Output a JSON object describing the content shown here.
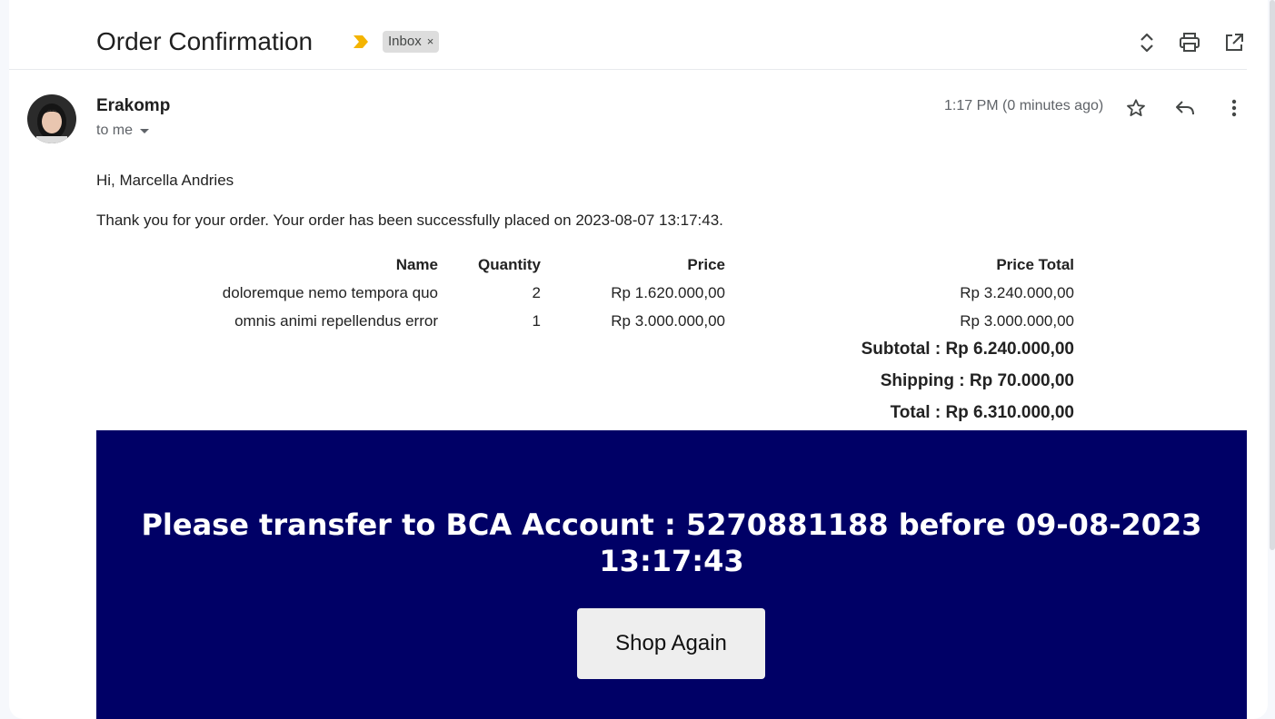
{
  "email": {
    "subject": "Order Confirmation",
    "label": "Inbox",
    "label_remove": "×",
    "sender_name": "Erakomp",
    "recipient": "to me",
    "timestamp": "1:17 PM (0 minutes ago)",
    "icons": {
      "expand": "unfold-icon",
      "print": "print-icon",
      "open_new_window": "open-in-new-icon",
      "star": "star-icon",
      "reply": "reply-icon",
      "more": "more-vert-icon",
      "importance": "importance-marker-icon"
    }
  },
  "body": {
    "greeting": "Hi, Marcella Andries",
    "message": "Thank you for your order. Your order has been successfully placed on 2023-08-07 13:17:43.",
    "table": {
      "headers": [
        "Name",
        "Quantity",
        "Price",
        "Price Total"
      ],
      "rows": [
        [
          "doloremque nemo tempora quo",
          "2",
          "Rp 1.620.000,00",
          "Rp 3.240.000,00"
        ],
        [
          "omnis animi repellendus error",
          "1",
          "Rp 3.000.000,00",
          "Rp 3.000.000,00"
        ]
      ]
    },
    "subtotal": "Subtotal : Rp 6.240.000,00",
    "shipping": "Shipping : Rp 70.000,00",
    "total": "Total : Rp 6.310.000,00",
    "banner": {
      "text": "Please transfer to BCA Account : 5270881188 before 09-08-2023 13:17:43",
      "button": "Shop Again",
      "background": "#000066"
    }
  },
  "colors": {
    "importance": "#f4b400",
    "chip_bg": "#dddddd"
  }
}
